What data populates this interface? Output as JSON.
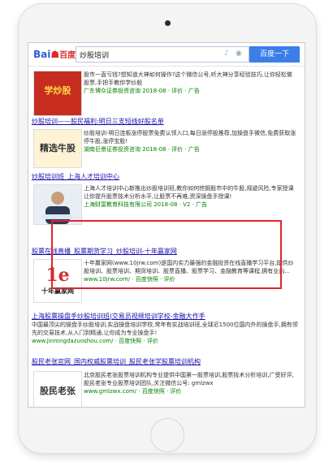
{
  "search": {
    "logo_brand": "Bai",
    "logo_paw": "☗",
    "logo_cn": "百度",
    "query": "炒股培训",
    "button_label": "百度一下",
    "mic_icon": "mic-icon",
    "camera_icon": "camera-icon"
  },
  "results": [
    {
      "title": "",
      "desc": "股市一直亏钱?想知道大神如何操作?这个微信公号,听大神分享经验技巧,让你轻松做股票,手把手教你学炒股",
      "meta": "广东博众证券投资咨询 2018-08 · 评价 · 广告",
      "thumb": "学炒股"
    },
    {
      "title": "炒股培训——股民福利:明日三支短线好股名单",
      "desc": "炒股培训-明日连板涨停股票免费认领入口,每日涨停股推荐,加操盘手微信,免费获取涨停牛股,涨停宝股!",
      "meta": "湖南巨景证券投资咨询 2018-08 · 评价 · 广告",
      "thumb": "精选牛股"
    },
    {
      "title": "炒股培训班_上海人才培训中心",
      "desc": "上海人才培训中心新推出炒股培训班,教你如何挖掘股市中的牛股,规避风险,专家授课让你提升股票技术分析水平,让股票不再难,资深操盘手授课!",
      "meta": "上海财富教育科技有限公司 2018-08 · V2 · 广告",
      "thumb": ""
    },
    {
      "title": "股票在线直播_股票期货学习_炒股培训-十年赢家网",
      "desc": "十年赢家网(www.10jrw.com)是国内实力最强的金融投资在线直播学习平台,提供炒股培训、股票培训、期货培训、股票直播、股票学习、金融教育等课程,拥有业内...",
      "meta": "www.10jrw.com/ · 百度快照 · 评价",
      "thumb": "十年赢家网"
    },
    {
      "title": "上海股票操盘手炒股培训班|交易员视频培训学校-金融大作手",
      "desc": "中国最顶尖的操盘手炒股培训,实战操盘培训学校,常年有实战培训班,全球近1500位国内外的操盘手,拥有领先的交易技术,从入门到精通,让你成为专业操盘手!",
      "meta": "www.jinrongdazuoshou.com/ · 百度快照 · 评价",
      "thumb": ""
    },
    {
      "title": "股民老张官网_国内权威股票培训_股民老张学股票培训机构",
      "desc": "北京股民老张股票培训机构专业提供中国第一股票培训,股票技术分析培训,广受好评,股民老张专业股票培训团队,关注微信公号: gmlzwx",
      "meta": "www.gmlzwx.com/ · 百度快照 · 评价",
      "thumb": "股民老张"
    }
  ],
  "colors": {
    "accent": "#3a7fe8",
    "link": "#1a0dab",
    "highlight_box": "#e0242b",
    "url_green": "#008000"
  }
}
